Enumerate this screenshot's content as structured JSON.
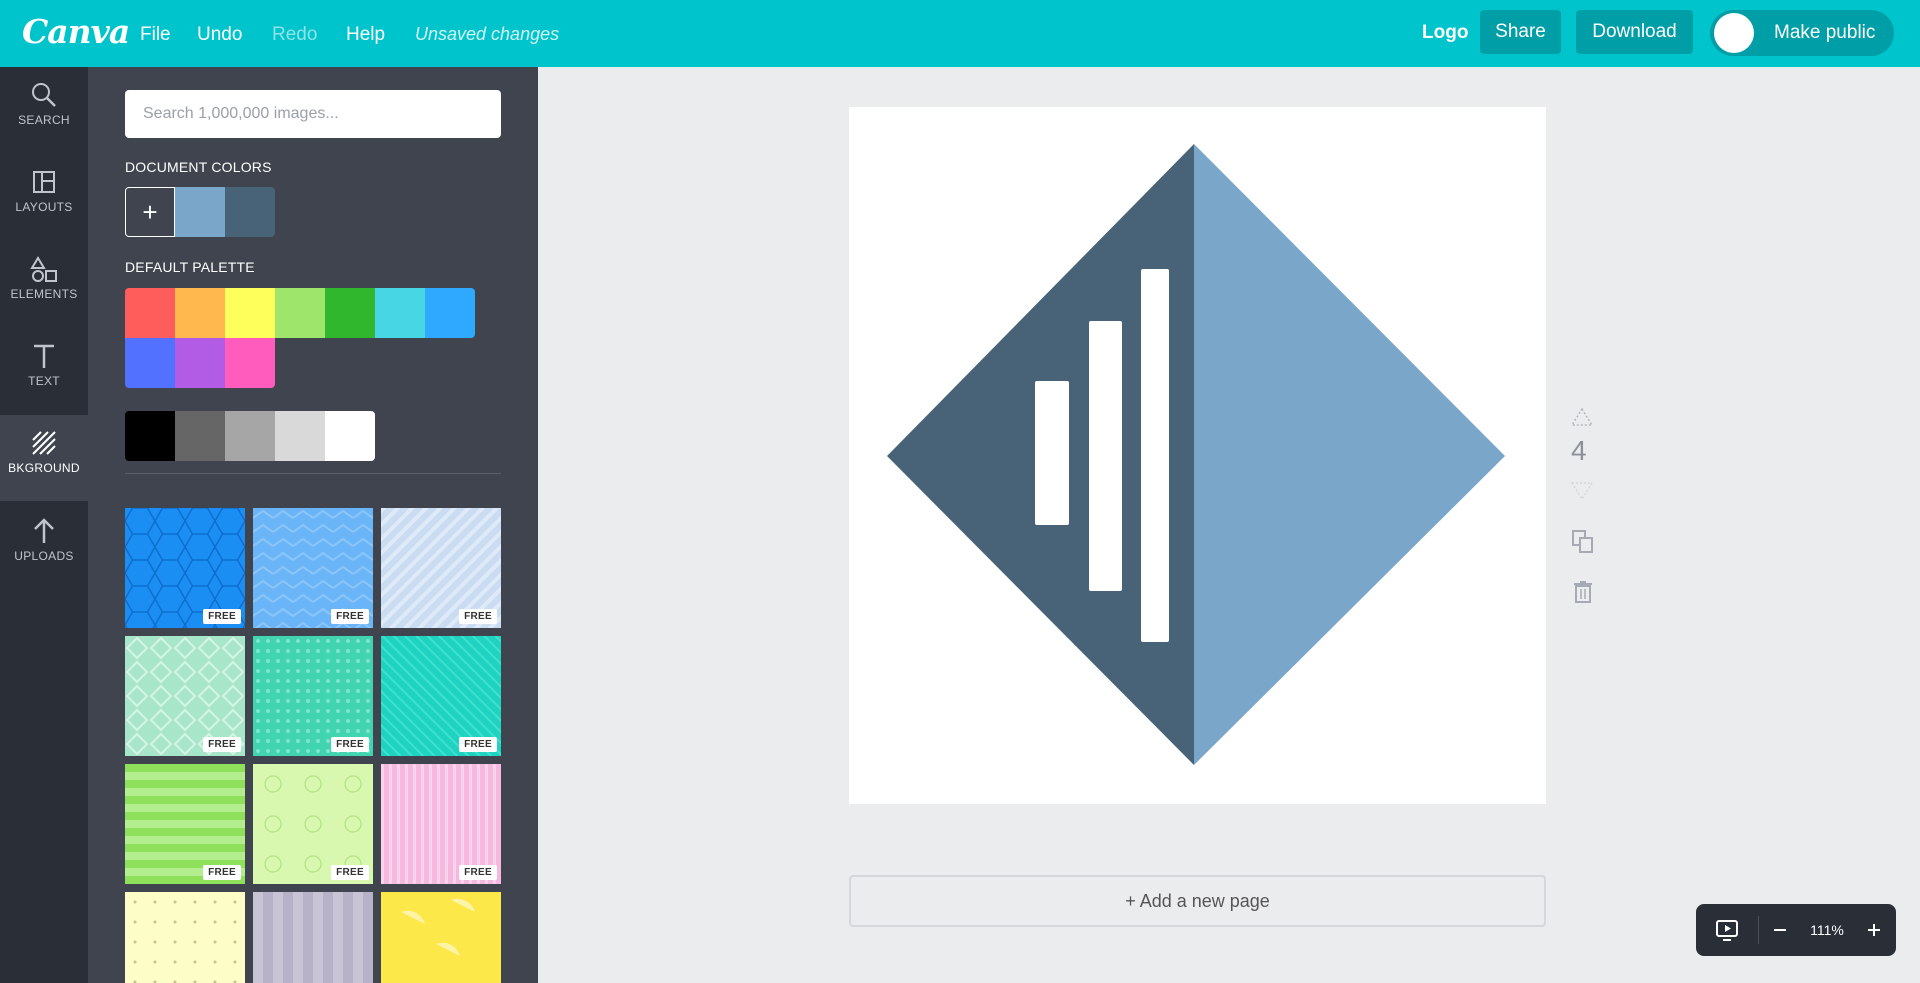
{
  "topbar": {
    "brand": "Canva",
    "menu": [
      "File",
      "Undo",
      "Redo",
      "Help"
    ],
    "status": "Unsaved changes",
    "doc_title": "Logo",
    "share_label": "Share",
    "download_label": "Download",
    "public_label": "Make public"
  },
  "rail": {
    "items": [
      {
        "label": "SEARCH",
        "icon": "search-icon"
      },
      {
        "label": "LAYOUTS",
        "icon": "layouts-icon"
      },
      {
        "label": "ELEMENTS",
        "icon": "elements-icon"
      },
      {
        "label": "TEXT",
        "icon": "text-icon"
      },
      {
        "label": "BKGROUND",
        "icon": "background-icon"
      },
      {
        "label": "UPLOADS",
        "icon": "upload-icon"
      }
    ],
    "active": "BKGROUND"
  },
  "panel": {
    "search_placeholder": "Search 1,000,000 images...",
    "document_colors_title": "DOCUMENT COLORS",
    "document_colors": [
      "#7aa7c9",
      "#486378"
    ],
    "add_color_symbol": "+",
    "default_palette_title": "DEFAULT PALETTE",
    "palette_row1": [
      "#ff5c5c",
      "#ffb84d",
      "#ffff5c",
      "#9ee66b",
      "#31b72e",
      "#47d7e4",
      "#2fa8ff"
    ],
    "palette_row2": [
      "#5271ff",
      "#b25be5",
      "#ff5cbe"
    ],
    "palette_grays": [
      "#000000",
      "#666666",
      "#a6a6a6",
      "#d9d9d9",
      "#ffffff"
    ],
    "free_badge": "FREE",
    "backgrounds": [
      {
        "name": "blue-hexagon-pattern",
        "free": true
      },
      {
        "name": "light-blue-zigzag-pattern",
        "free": true
      },
      {
        "name": "pale-blue-stripe-pattern",
        "free": true
      },
      {
        "name": "mint-diamond-pattern",
        "free": true
      },
      {
        "name": "teal-dot-pattern",
        "free": true
      },
      {
        "name": "turquoise-diagonal-pattern",
        "free": true
      },
      {
        "name": "green-stripe-pattern",
        "free": true
      },
      {
        "name": "lime-circle-pattern",
        "free": true
      },
      {
        "name": "pink-stripe-pattern",
        "free": true
      },
      {
        "name": "cream-dot-pattern",
        "free": false
      },
      {
        "name": "lavender-stripe-pattern",
        "free": false
      },
      {
        "name": "yellow-lemon-pattern",
        "free": false
      }
    ]
  },
  "canvas": {
    "page_number": "4",
    "add_page_label": "+ Add a new page",
    "zoom_level": "111%",
    "colors": {
      "dark": "#486378",
      "light": "#7aa7c9"
    }
  }
}
